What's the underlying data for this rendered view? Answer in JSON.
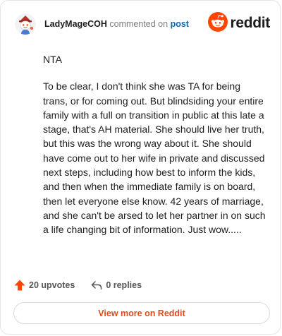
{
  "header": {
    "username": "LadyMageCOH",
    "commented_on": "commented on",
    "post_link": "post",
    "brand": "reddit"
  },
  "comment": {
    "paragraphs": [
      "NTA",
      "To be clear, I don't think she was TA for being trans, or for coming out. But blindsiding your entire family with a full on transition in public at this late a stage, that's AH material. She should live her truth, but this was the wrong way about it. She should have come out to her wife in private and discussed next steps, including how best to inform the kids, and then when the immediate family is on board, then let everyone else know. 42 years of marriage, and she can't be arsed to let her partner in on such a life changing bit of information. Just wow....."
    ]
  },
  "actions": {
    "upvotes": "20 upvotes",
    "replies": "0 replies"
  },
  "footer": {
    "view_more": "View more on Reddit"
  },
  "colors": {
    "accent": "#FF4500",
    "link": "#0A66C2",
    "view_more_text": "#E34A1D"
  },
  "icons": {
    "avatar": "snoo-avatar-icon",
    "brand": "reddit-snoo-icon",
    "upvote": "upvote-arrow-icon",
    "reply": "reply-arrow-icon"
  }
}
